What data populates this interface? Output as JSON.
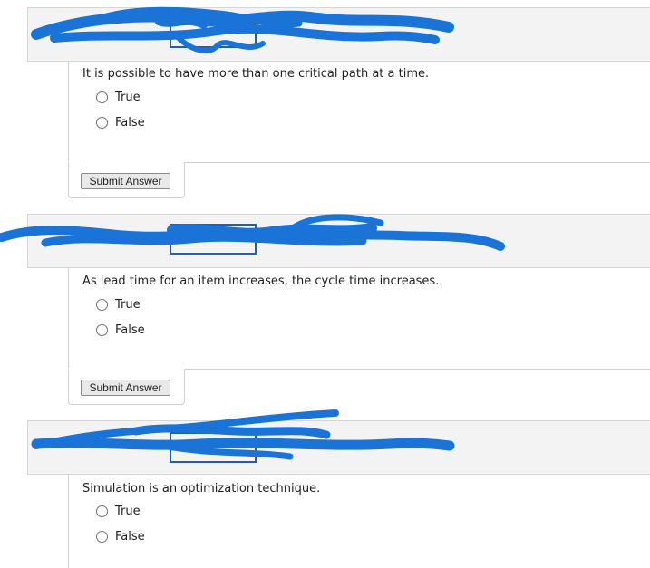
{
  "questions": [
    {
      "text": "It is possible to have more than one critical path at a time.",
      "options": [
        "True",
        "False"
      ],
      "submit_label": "Submit Answer"
    },
    {
      "text": "As lead time for an item increases, the cycle time increases.",
      "options": [
        "True",
        "False"
      ],
      "submit_label": "Submit Answer"
    },
    {
      "text": "Simulation is an optimization technique.",
      "options": [
        "True",
        "False"
      ]
    }
  ],
  "colors": {
    "header_bg": "#f3f3f3",
    "redaction": "#1a73d6",
    "box_border": "#1f5fb0"
  }
}
